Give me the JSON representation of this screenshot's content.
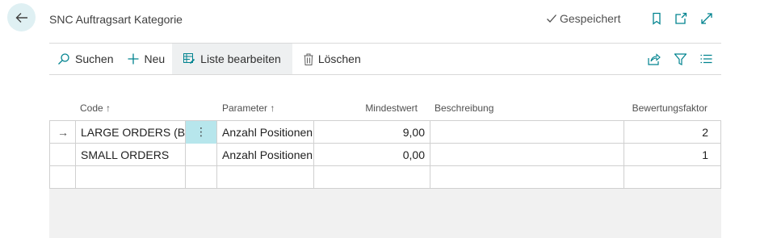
{
  "header": {
    "title": "SNC Auftragsart Kategorie",
    "saved_label": "Gespeichert",
    "icons": [
      "back-arrow-icon",
      "checkmark-icon",
      "bookmark-icon",
      "open-in-new-window-icon",
      "expand-icon"
    ]
  },
  "toolbar": {
    "search_label": "Suchen",
    "new_label": "Neu",
    "edit_list_label": "Liste bearbeiten",
    "delete_label": "Löschen",
    "icons": [
      "search-icon",
      "plus-icon",
      "edit-list-icon",
      "trash-icon",
      "share-icon",
      "filter-icon",
      "list-view-icon"
    ]
  },
  "columns": {
    "code": "Code ↑",
    "parameter": "Parameter ↑",
    "min_value": "Mindestwert",
    "description": "Beschreibung",
    "factor": "Bewertungsfaktor"
  },
  "rows": [
    {
      "indicator": "→",
      "code": "LARGE ORDERS (BI...",
      "menu": "⋮",
      "parameter": "Anzahl Positionen",
      "min_value": "9,00",
      "description": "",
      "factor": "2"
    },
    {
      "indicator": "",
      "code": "SMALL ORDERS",
      "menu": "",
      "parameter": "Anzahl Positionen",
      "min_value": "0,00",
      "description": "",
      "factor": "1"
    },
    {
      "indicator": "",
      "code": "",
      "menu": "",
      "parameter": "",
      "min_value": "",
      "description": "",
      "factor": ""
    }
  ],
  "colors": {
    "accent": "#00838f",
    "back_button_bg": "#dff0f3",
    "selected_cell": "#b7e6ec",
    "active_toolbar_bg": "#eef0f1"
  }
}
